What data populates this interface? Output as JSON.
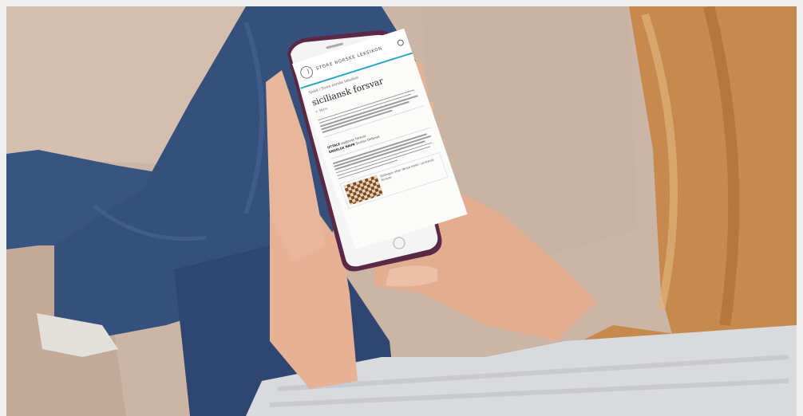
{
  "scene": {
    "description_hidden": "",
    "colors": {
      "sofa": "#cdb7a8",
      "jeans": "#35507a",
      "phone_case": "#5e2b4a",
      "hair": "#c98b4e",
      "skin": "#e8b59a",
      "sweater": "#dcdde0"
    }
  },
  "phone": {
    "site_name": "STORE NORSKE LEKSIKON",
    "search_icon": "search-icon",
    "breadcrumb": "Sjakk | Store norske leksikon",
    "article_title": "siciliansk forsvar",
    "share_label": "+ Skriv",
    "meta": [
      {
        "key": "UTTALE",
        "value": "sisiljansk forsvar"
      },
      {
        "key": "ENGELSK NAVN",
        "value": "Sicilian Defense"
      }
    ],
    "figure_caption": "Stillingen etter første trekk i siciliansk forsvar."
  }
}
